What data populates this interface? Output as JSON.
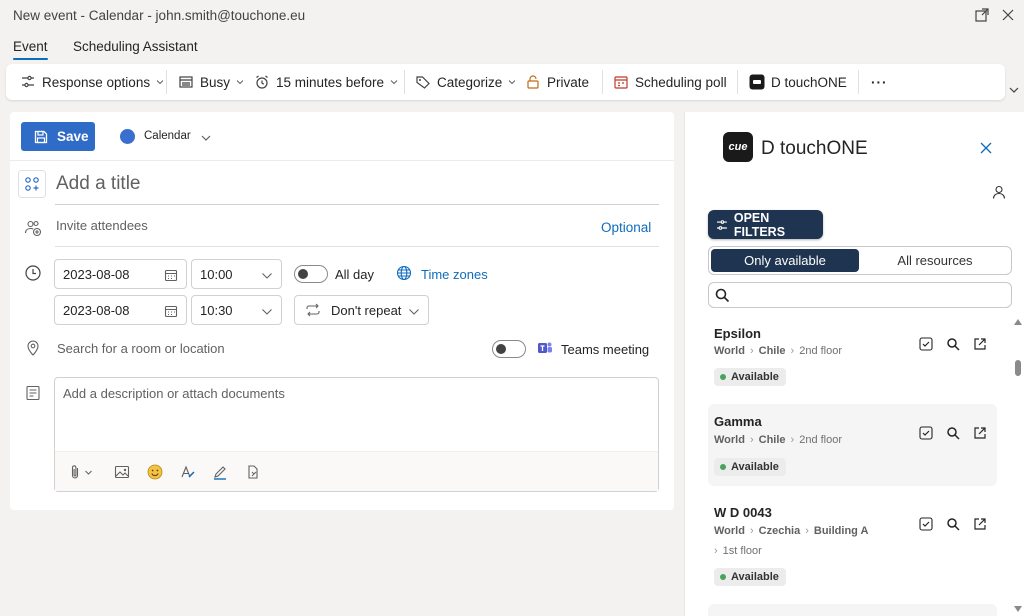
{
  "window": {
    "title": "New event - Calendar - john.smith@touchone.eu"
  },
  "tabs": [
    {
      "label": "Event"
    },
    {
      "label": "Scheduling Assistant"
    }
  ],
  "ribbon": {
    "response_options": "Response options",
    "busy": "Busy",
    "reminder": "15 minutes before",
    "categorize": "Categorize",
    "private": "Private",
    "scheduling_poll": "Scheduling poll",
    "addin": "D touchONE",
    "more": "···"
  },
  "form": {
    "save_label": "Save",
    "calendar_label": "Calendar",
    "title_placeholder": "Add a title",
    "attendees_placeholder": "Invite attendees",
    "optional_label": "Optional",
    "start_date": "2023-08-08",
    "start_time": "10:00",
    "end_date": "2023-08-08",
    "end_time": "10:30",
    "all_day_label": "All day",
    "time_zones_label": "Time zones",
    "repeat_label": "Don't repeat",
    "location_placeholder": "Search for a room or location",
    "teams_label": "Teams meeting",
    "description_placeholder": "Add a description or attach documents"
  },
  "panel": {
    "logo_text": "cue",
    "brand": "D touchONE",
    "filters_label": "OPEN FILTERS",
    "segment_available": "Only available",
    "segment_all": "All resources",
    "results": [
      {
        "name": "Epsilon",
        "path": [
          "World",
          "Chile"
        ],
        "floor": "2nd floor",
        "status": "Available"
      },
      {
        "name": "Gamma",
        "path": [
          "World",
          "Chile"
        ],
        "floor": "2nd floor",
        "status": "Available"
      },
      {
        "name": "W D 0043",
        "path": [
          "World",
          "Czechia",
          "Building A"
        ],
        "floor": "1st floor",
        "status": "Available"
      }
    ]
  },
  "colors": {
    "accent": "#0f6cbd",
    "save": "#2f6cc7",
    "panel_dark": "#1f3450",
    "available": "#4aa35a"
  }
}
